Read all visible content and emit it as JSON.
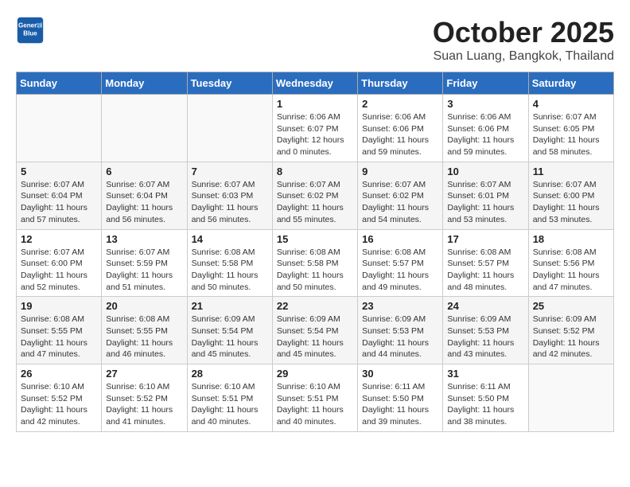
{
  "header": {
    "logo_line1": "General",
    "logo_line2": "Blue",
    "month": "October 2025",
    "location": "Suan Luang, Bangkok, Thailand"
  },
  "weekdays": [
    "Sunday",
    "Monday",
    "Tuesday",
    "Wednesday",
    "Thursday",
    "Friday",
    "Saturday"
  ],
  "weeks": [
    [
      {
        "day": "",
        "sunrise": "",
        "sunset": "",
        "daylight": ""
      },
      {
        "day": "",
        "sunrise": "",
        "sunset": "",
        "daylight": ""
      },
      {
        "day": "",
        "sunrise": "",
        "sunset": "",
        "daylight": ""
      },
      {
        "day": "1",
        "sunrise": "Sunrise: 6:06 AM",
        "sunset": "Sunset: 6:07 PM",
        "daylight": "Daylight: 12 hours and 0 minutes."
      },
      {
        "day": "2",
        "sunrise": "Sunrise: 6:06 AM",
        "sunset": "Sunset: 6:06 PM",
        "daylight": "Daylight: 11 hours and 59 minutes."
      },
      {
        "day": "3",
        "sunrise": "Sunrise: 6:06 AM",
        "sunset": "Sunset: 6:06 PM",
        "daylight": "Daylight: 11 hours and 59 minutes."
      },
      {
        "day": "4",
        "sunrise": "Sunrise: 6:07 AM",
        "sunset": "Sunset: 6:05 PM",
        "daylight": "Daylight: 11 hours and 58 minutes."
      }
    ],
    [
      {
        "day": "5",
        "sunrise": "Sunrise: 6:07 AM",
        "sunset": "Sunset: 6:04 PM",
        "daylight": "Daylight: 11 hours and 57 minutes."
      },
      {
        "day": "6",
        "sunrise": "Sunrise: 6:07 AM",
        "sunset": "Sunset: 6:04 PM",
        "daylight": "Daylight: 11 hours and 56 minutes."
      },
      {
        "day": "7",
        "sunrise": "Sunrise: 6:07 AM",
        "sunset": "Sunset: 6:03 PM",
        "daylight": "Daylight: 11 hours and 56 minutes."
      },
      {
        "day": "8",
        "sunrise": "Sunrise: 6:07 AM",
        "sunset": "Sunset: 6:02 PM",
        "daylight": "Daylight: 11 hours and 55 minutes."
      },
      {
        "day": "9",
        "sunrise": "Sunrise: 6:07 AM",
        "sunset": "Sunset: 6:02 PM",
        "daylight": "Daylight: 11 hours and 54 minutes."
      },
      {
        "day": "10",
        "sunrise": "Sunrise: 6:07 AM",
        "sunset": "Sunset: 6:01 PM",
        "daylight": "Daylight: 11 hours and 53 minutes."
      },
      {
        "day": "11",
        "sunrise": "Sunrise: 6:07 AM",
        "sunset": "Sunset: 6:00 PM",
        "daylight": "Daylight: 11 hours and 53 minutes."
      }
    ],
    [
      {
        "day": "12",
        "sunrise": "Sunrise: 6:07 AM",
        "sunset": "Sunset: 6:00 PM",
        "daylight": "Daylight: 11 hours and 52 minutes."
      },
      {
        "day": "13",
        "sunrise": "Sunrise: 6:07 AM",
        "sunset": "Sunset: 5:59 PM",
        "daylight": "Daylight: 11 hours and 51 minutes."
      },
      {
        "day": "14",
        "sunrise": "Sunrise: 6:08 AM",
        "sunset": "Sunset: 5:58 PM",
        "daylight": "Daylight: 11 hours and 50 minutes."
      },
      {
        "day": "15",
        "sunrise": "Sunrise: 6:08 AM",
        "sunset": "Sunset: 5:58 PM",
        "daylight": "Daylight: 11 hours and 50 minutes."
      },
      {
        "day": "16",
        "sunrise": "Sunrise: 6:08 AM",
        "sunset": "Sunset: 5:57 PM",
        "daylight": "Daylight: 11 hours and 49 minutes."
      },
      {
        "day": "17",
        "sunrise": "Sunrise: 6:08 AM",
        "sunset": "Sunset: 5:57 PM",
        "daylight": "Daylight: 11 hours and 48 minutes."
      },
      {
        "day": "18",
        "sunrise": "Sunrise: 6:08 AM",
        "sunset": "Sunset: 5:56 PM",
        "daylight": "Daylight: 11 hours and 47 minutes."
      }
    ],
    [
      {
        "day": "19",
        "sunrise": "Sunrise: 6:08 AM",
        "sunset": "Sunset: 5:55 PM",
        "daylight": "Daylight: 11 hours and 47 minutes."
      },
      {
        "day": "20",
        "sunrise": "Sunrise: 6:08 AM",
        "sunset": "Sunset: 5:55 PM",
        "daylight": "Daylight: 11 hours and 46 minutes."
      },
      {
        "day": "21",
        "sunrise": "Sunrise: 6:09 AM",
        "sunset": "Sunset: 5:54 PM",
        "daylight": "Daylight: 11 hours and 45 minutes."
      },
      {
        "day": "22",
        "sunrise": "Sunrise: 6:09 AM",
        "sunset": "Sunset: 5:54 PM",
        "daylight": "Daylight: 11 hours and 45 minutes."
      },
      {
        "day": "23",
        "sunrise": "Sunrise: 6:09 AM",
        "sunset": "Sunset: 5:53 PM",
        "daylight": "Daylight: 11 hours and 44 minutes."
      },
      {
        "day": "24",
        "sunrise": "Sunrise: 6:09 AM",
        "sunset": "Sunset: 5:53 PM",
        "daylight": "Daylight: 11 hours and 43 minutes."
      },
      {
        "day": "25",
        "sunrise": "Sunrise: 6:09 AM",
        "sunset": "Sunset: 5:52 PM",
        "daylight": "Daylight: 11 hours and 42 minutes."
      }
    ],
    [
      {
        "day": "26",
        "sunrise": "Sunrise: 6:10 AM",
        "sunset": "Sunset: 5:52 PM",
        "daylight": "Daylight: 11 hours and 42 minutes."
      },
      {
        "day": "27",
        "sunrise": "Sunrise: 6:10 AM",
        "sunset": "Sunset: 5:52 PM",
        "daylight": "Daylight: 11 hours and 41 minutes."
      },
      {
        "day": "28",
        "sunrise": "Sunrise: 6:10 AM",
        "sunset": "Sunset: 5:51 PM",
        "daylight": "Daylight: 11 hours and 40 minutes."
      },
      {
        "day": "29",
        "sunrise": "Sunrise: 6:10 AM",
        "sunset": "Sunset: 5:51 PM",
        "daylight": "Daylight: 11 hours and 40 minutes."
      },
      {
        "day": "30",
        "sunrise": "Sunrise: 6:11 AM",
        "sunset": "Sunset: 5:50 PM",
        "daylight": "Daylight: 11 hours and 39 minutes."
      },
      {
        "day": "31",
        "sunrise": "Sunrise: 6:11 AM",
        "sunset": "Sunset: 5:50 PM",
        "daylight": "Daylight: 11 hours and 38 minutes."
      },
      {
        "day": "",
        "sunrise": "",
        "sunset": "",
        "daylight": ""
      }
    ]
  ]
}
